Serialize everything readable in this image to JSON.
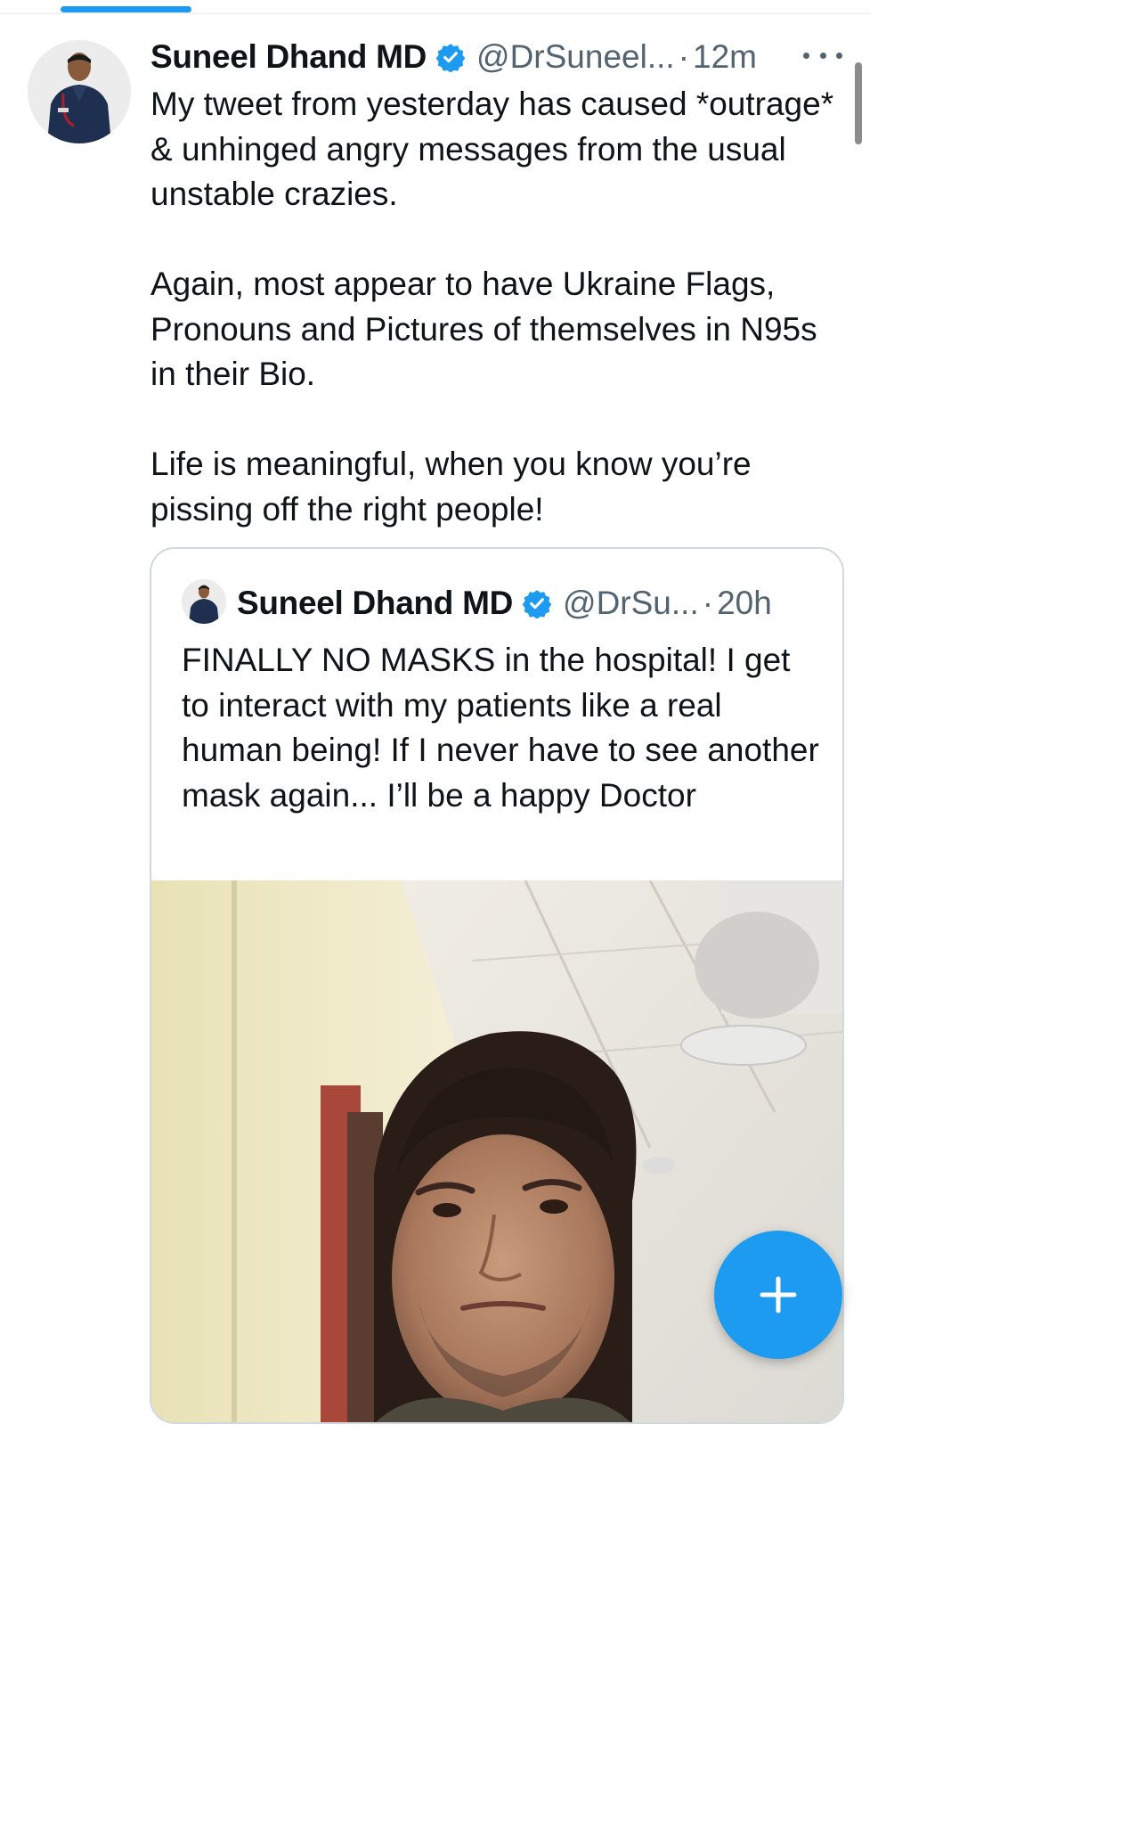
{
  "tweet": {
    "author_name": "Suneel Dhand MD",
    "handle": "@DrSuneel...",
    "separator": "·",
    "time": "12m",
    "paragraphs": [
      "My tweet from yesterday has caused *outrage* & unhinged angry messages from the usual unstable crazies.",
      "Again, most appear to have Ukraine Flags, Pronouns and Pictures of themselves in N95s in their Bio.",
      "Life is meaningful, when you know you’re pissing off the right people!"
    ]
  },
  "quoted_tweet": {
    "author_name": "Suneel Dhand MD",
    "handle": "@DrSu...",
    "separator": "·",
    "time": "20h",
    "text": "FINALLY NO MASKS in the hospital! I get to interact with my patients like a real human being! If I never have to see another mask again... I’ll be a happy Doctor"
  },
  "icons": {
    "verified": "verified-badge-icon",
    "more": "more-options-icon",
    "compose": "plus-icon"
  },
  "colors": {
    "accent": "#1d9bf0",
    "text_primary": "#0f1419",
    "text_secondary": "#536471",
    "border": "#cfd9de"
  }
}
